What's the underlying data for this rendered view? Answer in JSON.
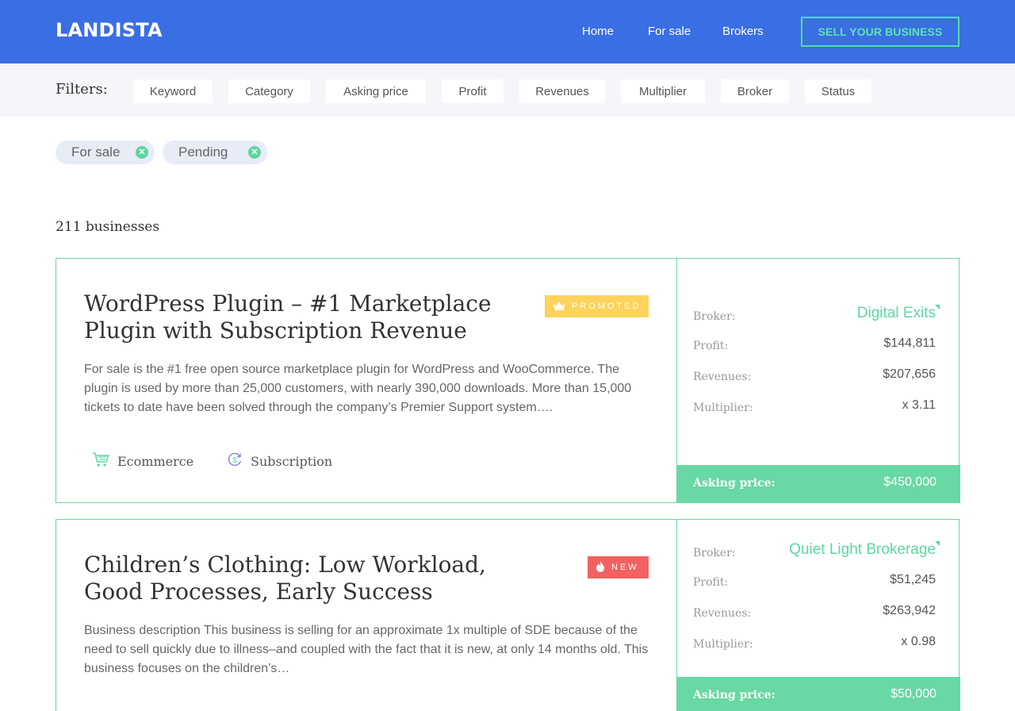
{
  "header": {
    "logo": "LANDISTA",
    "nav": [
      "Home",
      "For sale",
      "Brokers"
    ],
    "cta": "SELL YOUR BUSINESS"
  },
  "filters": {
    "label": "Filters:",
    "items": [
      "Keyword",
      "Category",
      "Asking price",
      "Profit",
      "Revenues",
      "Multiplier",
      "Broker",
      "Status"
    ]
  },
  "active_tags": [
    {
      "label": "For sale"
    },
    {
      "label": "Pending"
    }
  ],
  "results": {
    "count": "211 businesses"
  },
  "listings": [
    {
      "title": "WordPress Plugin – #1 Marketplace Plugin with Subscription Revenue",
      "badge": "PROMOTED",
      "badge_icon": "crown-icon",
      "description": "For sale is the #1 free open source marketplace plugin for WordPress and WooCommerce. The plugin is used by more than 25,000 customers, with nearly 390,000 downloads. More than 15,000 tickets to date have been solved through the company’s Premier Support system….",
      "categories": [
        {
          "label": "Ecommerce",
          "icon": "cart-icon"
        },
        {
          "label": "Subscription",
          "icon": "subscription-icon"
        }
      ],
      "broker_label": "Broker:",
      "broker": "Digital Exits",
      "profit_label": "Profit:",
      "profit": "$144,811",
      "revenues_label": "Revenues:",
      "revenues": "$207,656",
      "multiplier_label": "Multiplier:",
      "multiplier": "x 3.11",
      "asking_label": "Asking price:",
      "asking": "$450,000"
    },
    {
      "title": "Children’s Clothing: Low Workload, Good Processes, Early Success",
      "badge": "NEW",
      "badge_icon": "fire-icon",
      "description": "Business description This business is selling for an approximate 1x multiple of SDE because of the need to sell quickly due to illness–and coupled with the fact that it is new, at only 14 months old. This business focuses on the children’s…",
      "broker_label": "Broker:",
      "broker": "Quiet Light Brokerage",
      "profit_label": "Profit:",
      "profit": "$51,245",
      "revenues_label": "Revenues:",
      "revenues": "$263,942",
      "multiplier_label": "Multiplier:",
      "multiplier": "x 0.98",
      "asking_label": "Asking price:",
      "asking": "$50,000"
    }
  ],
  "colors": {
    "primary": "#3a6ee3",
    "accent": "#5fd6a0",
    "promoted": "#ffd35c",
    "new": "#f26262"
  }
}
